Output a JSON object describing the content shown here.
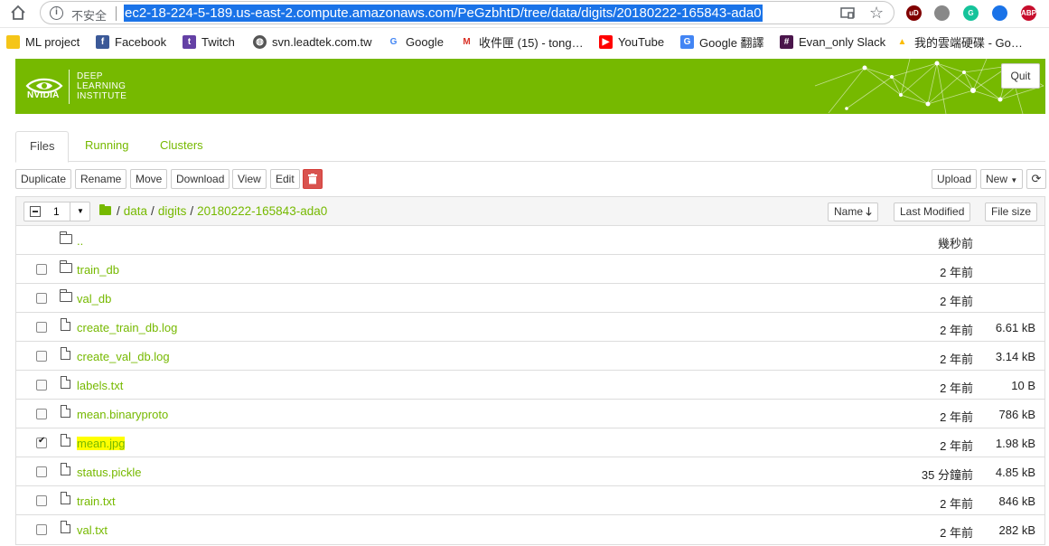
{
  "browser": {
    "insecure_label": "不安全",
    "url": "ec2-18-224-5-189.us-east-2.compute.amazonaws.com/PeGzbhtD/tree/data/digits/20180222-165843-ada0",
    "extensions": [
      {
        "name": "ublock-extension-icon",
        "label": "uD",
        "color": "#800000"
      },
      {
        "name": "bike-extension-icon",
        "label": "",
        "color": "#888888"
      },
      {
        "name": "grammarly-extension-icon",
        "label": "G",
        "color": "#15c39a"
      },
      {
        "name": "notification-extension-icon",
        "label": "",
        "color": "#1a73e8"
      },
      {
        "name": "adblock-plus-extension-icon",
        "label": "ABP",
        "color": "#c70d2c"
      }
    ],
    "bookmarks": [
      {
        "label": "ML project",
        "icon": "folder-icon",
        "color": "#f5c518"
      },
      {
        "label": "Facebook",
        "icon": "facebook-icon",
        "color": "#3b5998"
      },
      {
        "label": "Twitch",
        "icon": "twitch-icon",
        "color": "#6441a5"
      },
      {
        "label": "svn.leadtek.com.tw",
        "icon": "globe-icon",
        "color": "#555555"
      },
      {
        "label": "Google",
        "icon": "google-icon",
        "color": "#ffffff"
      },
      {
        "label": "收件匣 (15) - tong…",
        "icon": "gmail-icon",
        "color": "#ffffff"
      },
      {
        "label": "YouTube",
        "icon": "youtube-icon",
        "color": "#ff0000"
      },
      {
        "label": "Google 翻譯",
        "icon": "translate-icon",
        "color": "#4285f4"
      },
      {
        "label": "Evan_only Slack",
        "icon": "slack-icon",
        "color": "#4a154b"
      },
      {
        "label": "我的雲端硬碟 - Go…",
        "icon": "drive-icon",
        "color": "#ffffff"
      }
    ]
  },
  "header": {
    "logo_brand": "NVIDIA",
    "logo_lines": [
      "DEEP",
      "LEARNING",
      "INSTITUTE"
    ],
    "quit_label": "Quit",
    "brand_color": "#76b900"
  },
  "tabs": [
    {
      "label": "Files",
      "active": true
    },
    {
      "label": "Running",
      "active": false
    },
    {
      "label": "Clusters",
      "active": false
    }
  ],
  "toolbar": {
    "duplicate": "Duplicate",
    "rename": "Rename",
    "move": "Move",
    "download": "Download",
    "view": "View",
    "edit": "Edit",
    "delete_icon": "trash-icon",
    "upload": "Upload",
    "new": "New",
    "refresh_icon": "refresh-icon"
  },
  "listing": {
    "selected_count": "1",
    "breadcrumb": [
      "data",
      "digits",
      "20180222-165843-ada0"
    ],
    "sort_name": "Name",
    "sort_modified": "Last Modified",
    "sort_size": "File size",
    "parent": {
      "name": "..",
      "modified": "幾秒前"
    },
    "rows": [
      {
        "name": "train_db",
        "type": "folder",
        "modified": "2 年前",
        "size": "",
        "checked": false,
        "highlight": false
      },
      {
        "name": "val_db",
        "type": "folder",
        "modified": "2 年前",
        "size": "",
        "checked": false,
        "highlight": false
      },
      {
        "name": "create_train_db.log",
        "type": "file",
        "modified": "2 年前",
        "size": "6.61 kB",
        "checked": false,
        "highlight": false
      },
      {
        "name": "create_val_db.log",
        "type": "file",
        "modified": "2 年前",
        "size": "3.14 kB",
        "checked": false,
        "highlight": false
      },
      {
        "name": "labels.txt",
        "type": "file",
        "modified": "2 年前",
        "size": "10 B",
        "checked": false,
        "highlight": false
      },
      {
        "name": "mean.binaryproto",
        "type": "file",
        "modified": "2 年前",
        "size": "786 kB",
        "checked": false,
        "highlight": false
      },
      {
        "name": "mean.jpg",
        "type": "file",
        "modified": "2 年前",
        "size": "1.98 kB",
        "checked": true,
        "highlight": true
      },
      {
        "name": "status.pickle",
        "type": "file",
        "modified": "35 分鐘前",
        "size": "4.85 kB",
        "checked": false,
        "highlight": false
      },
      {
        "name": "train.txt",
        "type": "file",
        "modified": "2 年前",
        "size": "846 kB",
        "checked": false,
        "highlight": false
      },
      {
        "name": "val.txt",
        "type": "file",
        "modified": "2 年前",
        "size": "282 kB",
        "checked": false,
        "highlight": false
      }
    ]
  }
}
